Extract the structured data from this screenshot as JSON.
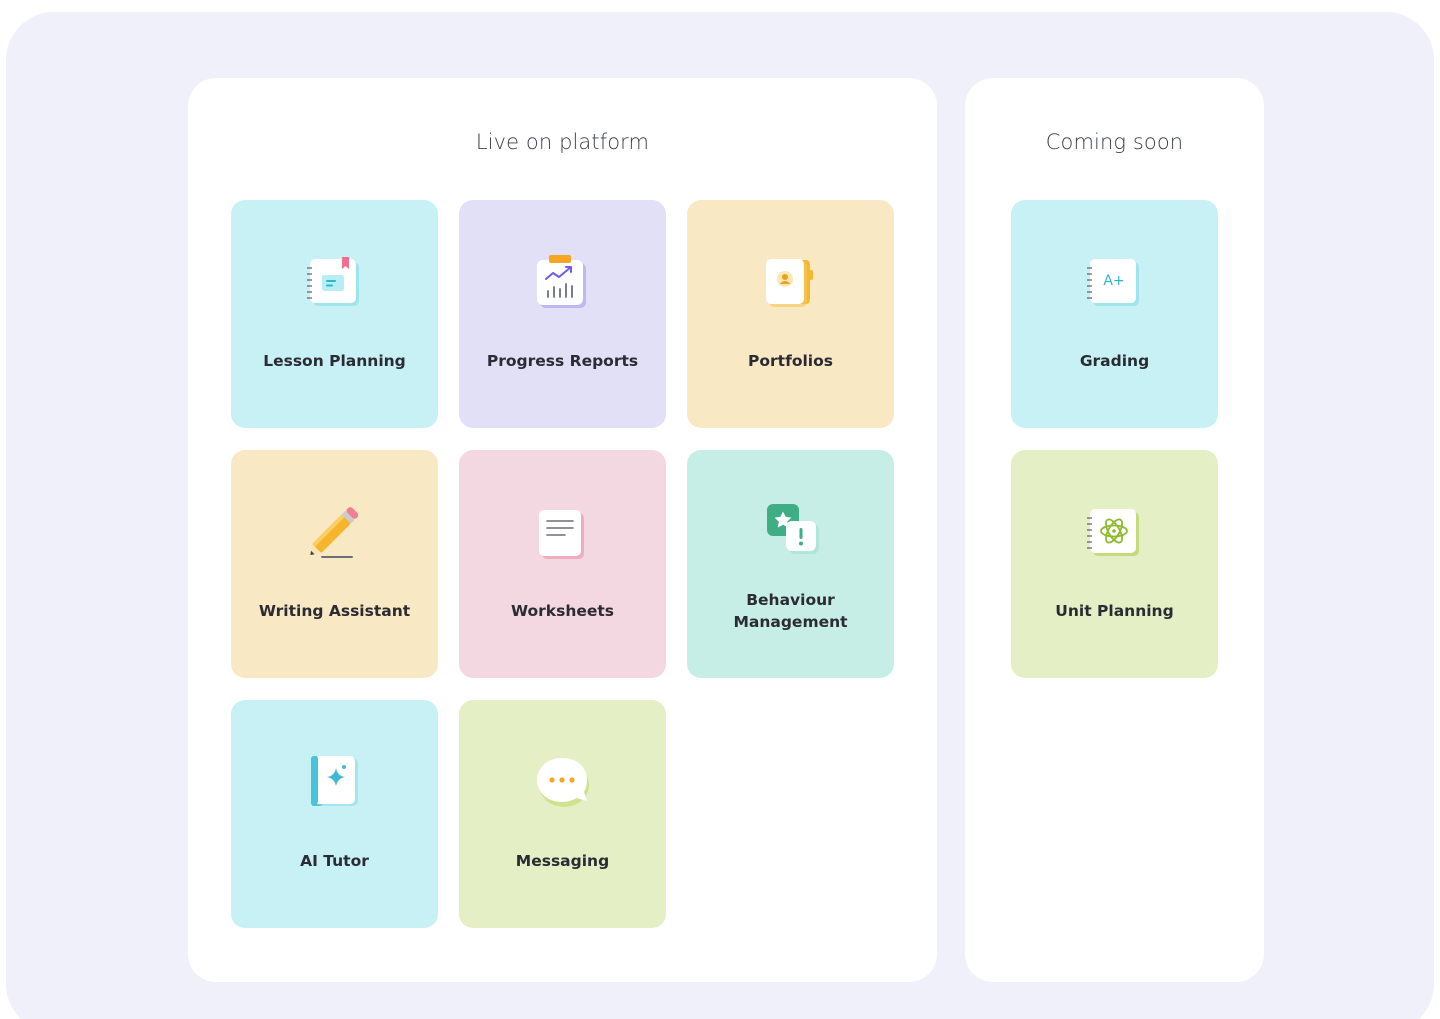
{
  "live": {
    "title": "Live on platform",
    "tiles": [
      {
        "label": "Lesson Planning",
        "icon": "lesson-planning-notebook-icon",
        "color": "#c8f1f6"
      },
      {
        "label": "Progress Reports",
        "icon": "progress-report-clipboard-icon",
        "color": "#e1e0f7"
      },
      {
        "label": "Portfolios",
        "icon": "portfolio-folder-icon",
        "color": "#f8e9c4"
      },
      {
        "label": "Writing Assistant",
        "icon": "pencil-icon",
        "color": "#f8e9c4"
      },
      {
        "label": "Worksheets",
        "icon": "worksheet-document-icon",
        "color": "#f3d7e1"
      },
      {
        "label": "Behaviour Management",
        "icon": "behaviour-star-alert-icon",
        "color": "#c7eee6"
      },
      {
        "label": "AI Tutor",
        "icon": "ai-sparkle-book-icon",
        "color": "#c8f1f6"
      },
      {
        "label": "Messaging",
        "icon": "chat-bubble-icon",
        "color": "#e5efc5"
      }
    ]
  },
  "soon": {
    "title": "Coming soon",
    "tiles": [
      {
        "label": "Grading",
        "icon": "grade-a-plus-notebook-icon",
        "color": "#c8f1f6"
      },
      {
        "label": "Unit Planning",
        "icon": "atom-notebook-icon",
        "color": "#e5efc5"
      }
    ],
    "grading_mark": "A+"
  }
}
